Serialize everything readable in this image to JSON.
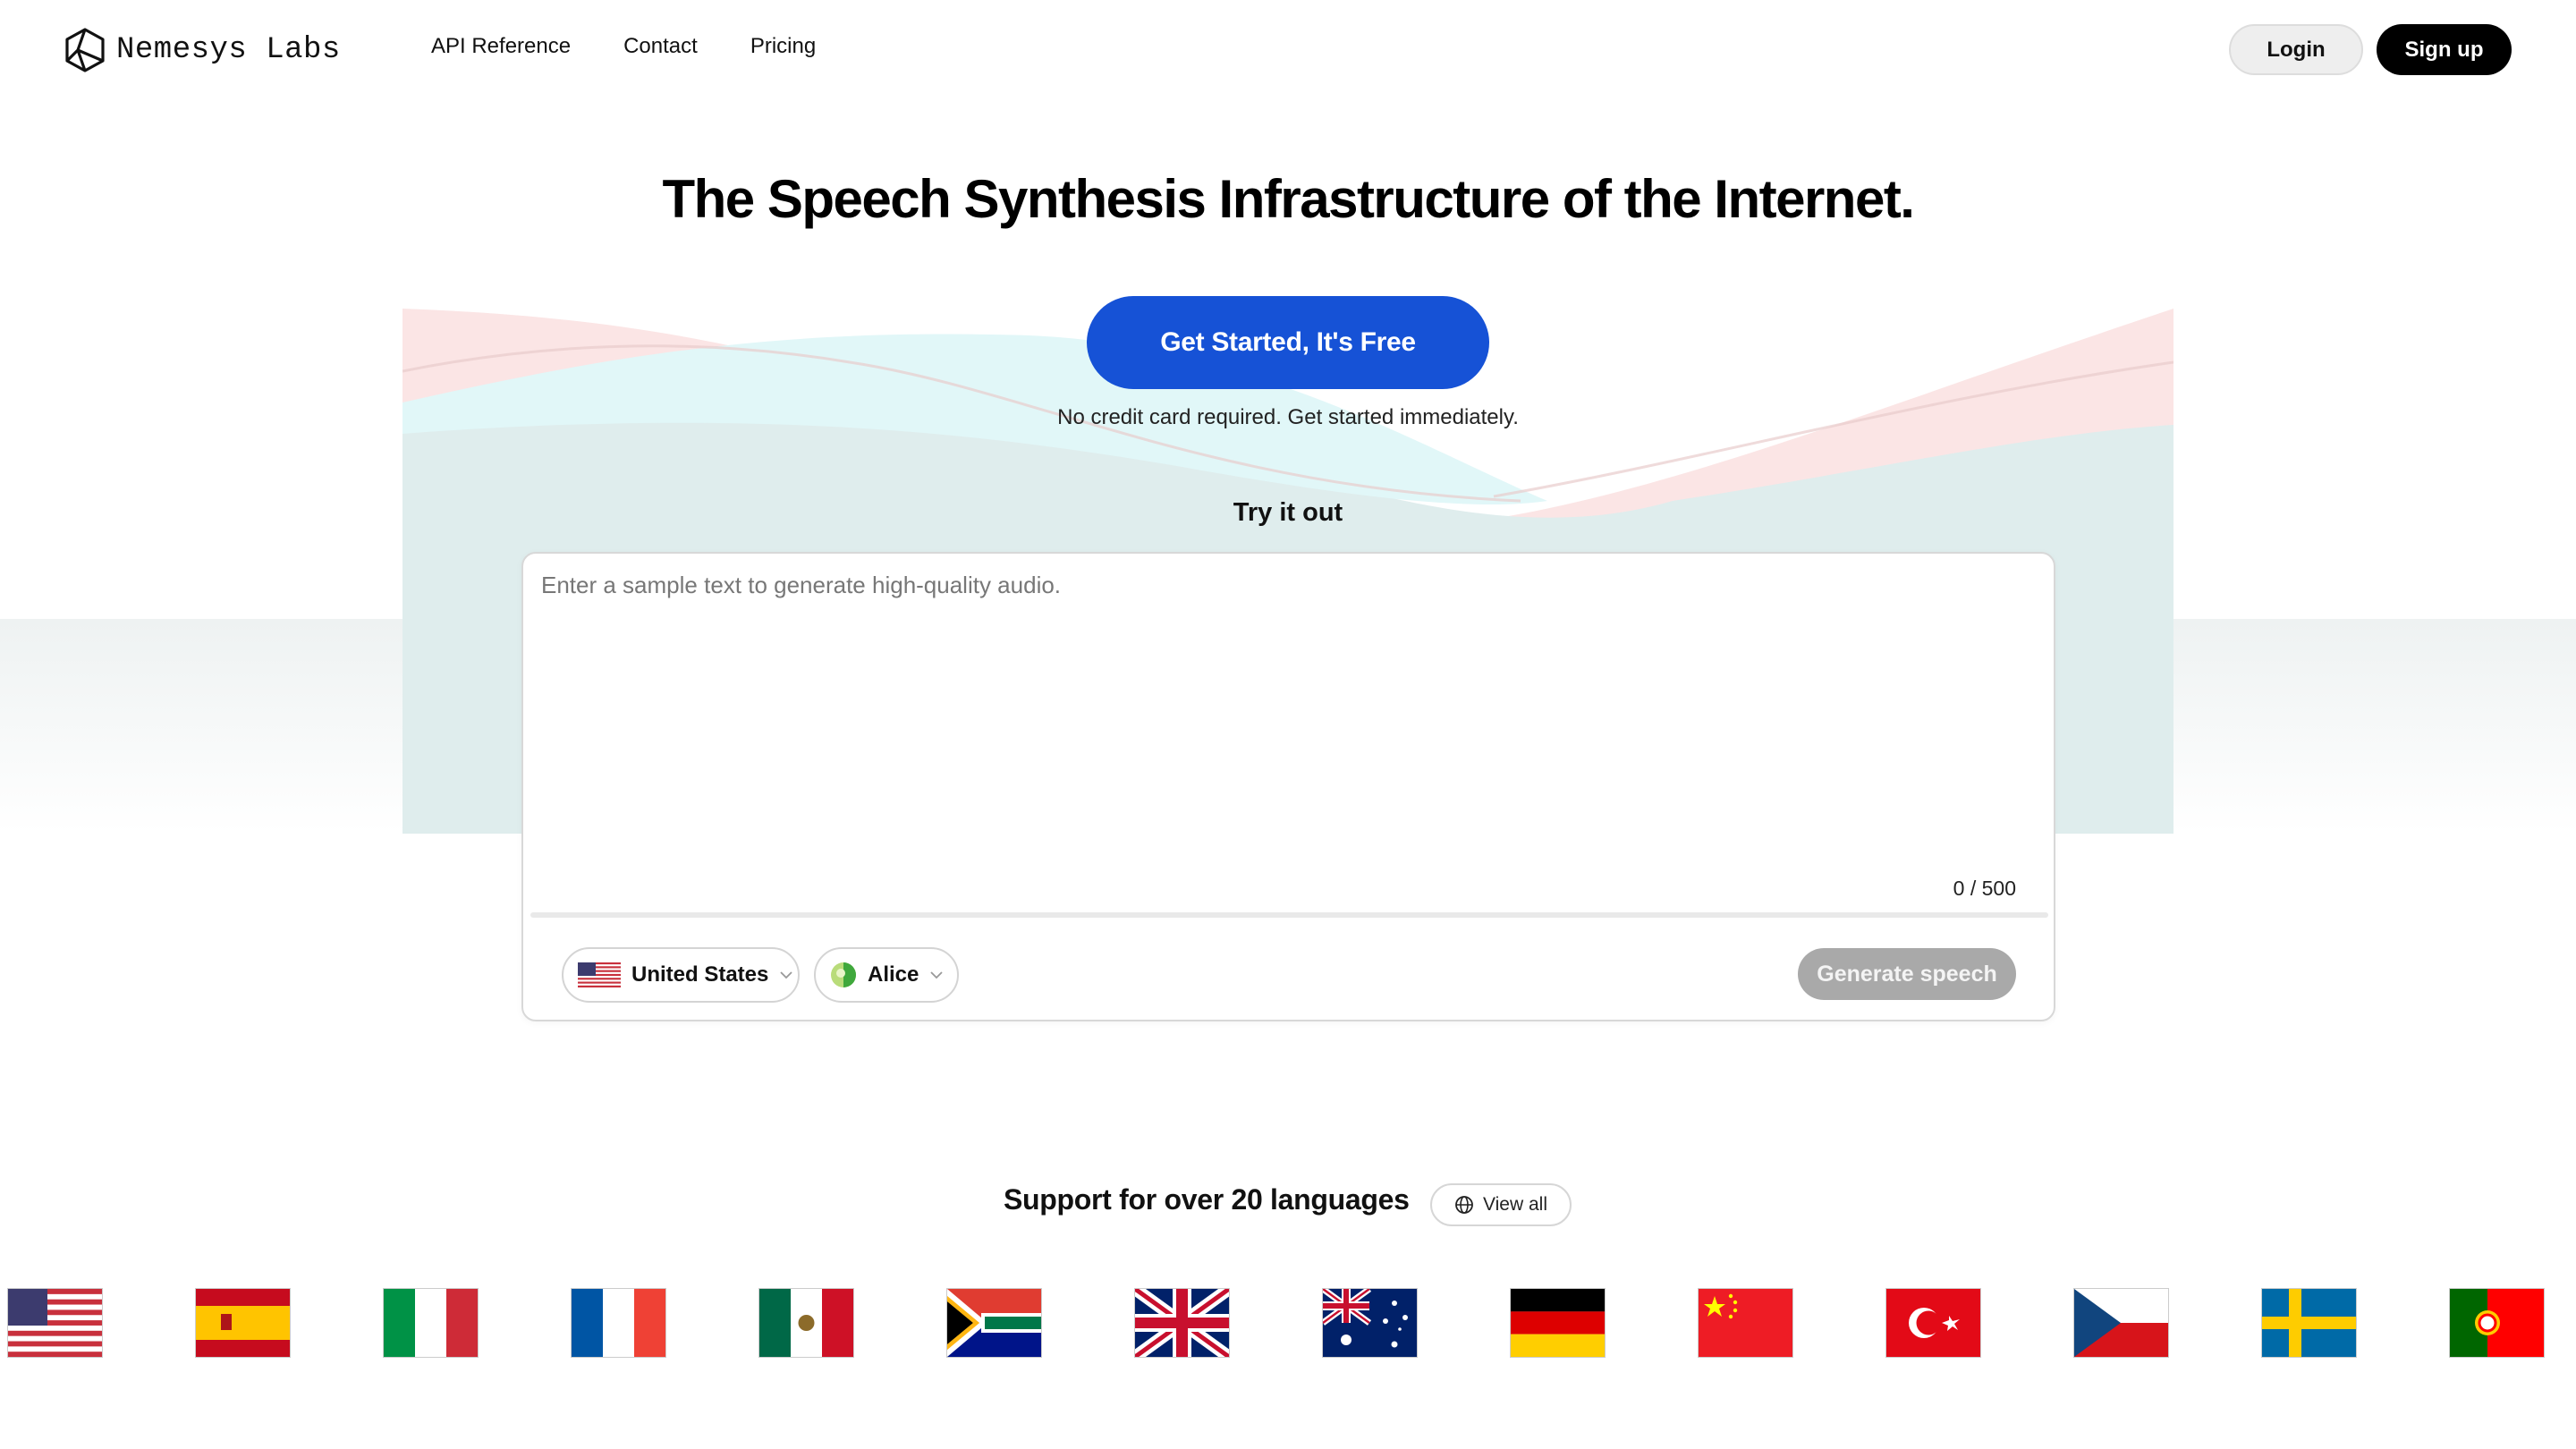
{
  "brand": {
    "name": "Nemesys Labs",
    "icon": "hexagon-cube-logo-icon"
  },
  "nav": {
    "links": [
      {
        "label": "API Reference"
      },
      {
        "label": "Contact"
      },
      {
        "label": "Pricing"
      }
    ],
    "login_label": "Login",
    "signup_label": "Sign up"
  },
  "hero": {
    "title": "The Speech Synthesis Infrastructure of the Internet.",
    "cta_label": "Get Started, It's Free",
    "cta_note": "No credit card required. Get started immediately."
  },
  "demo": {
    "section_label": "Try it out",
    "text_value": "",
    "text_placeholder": "Enter a sample text to generate high-quality audio.",
    "char_count": "0 / 500",
    "country_label": "United States",
    "country_flag": "us-flag-icon",
    "voice_label": "Alice",
    "voice_icon": "voice-avatar-icon",
    "generate_label": "Generate speech"
  },
  "languages": {
    "heading": "Support for over 20 languages",
    "view_all_label": "View all",
    "view_all_icon": "globe-icon",
    "flags": [
      {
        "country": "United States"
      },
      {
        "country": "Spain"
      },
      {
        "country": "Italy"
      },
      {
        "country": "France"
      },
      {
        "country": "Mexico"
      },
      {
        "country": "South Africa"
      },
      {
        "country": "United Kingdom"
      },
      {
        "country": "Australia"
      },
      {
        "country": "Germany"
      },
      {
        "country": "China"
      },
      {
        "country": "Turkey"
      },
      {
        "country": "Czech Republic"
      },
      {
        "country": "Sweden"
      },
      {
        "country": "Portugal"
      }
    ]
  },
  "colors": {
    "primary_cta": "#1652d6",
    "signup_bg": "#000000",
    "login_bg": "#eeeeee",
    "generate_disabled": "#a9a9a9",
    "wave_pink": "#fbe5e5",
    "wave_teal": "#ddecec",
    "wave_cyan": "#e1f7f8"
  }
}
